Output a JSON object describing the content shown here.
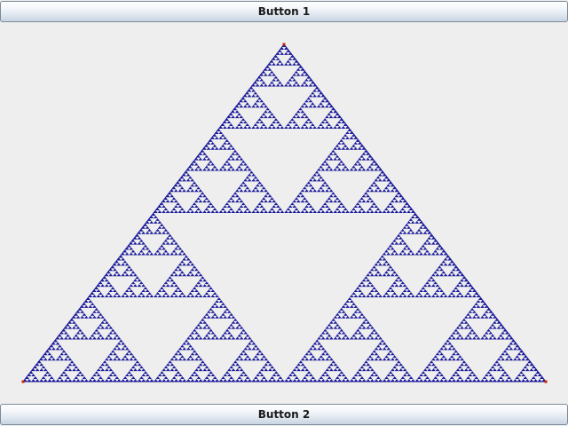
{
  "buttons": {
    "top_label": "Button 1",
    "bottom_label": "Button 2"
  },
  "fractal": {
    "name": "sierpinski-triangle",
    "fill_color": "#1a1a99",
    "vertex_marker_color": "#cc2200",
    "background_color": "#eeeeee",
    "depth": 7
  }
}
